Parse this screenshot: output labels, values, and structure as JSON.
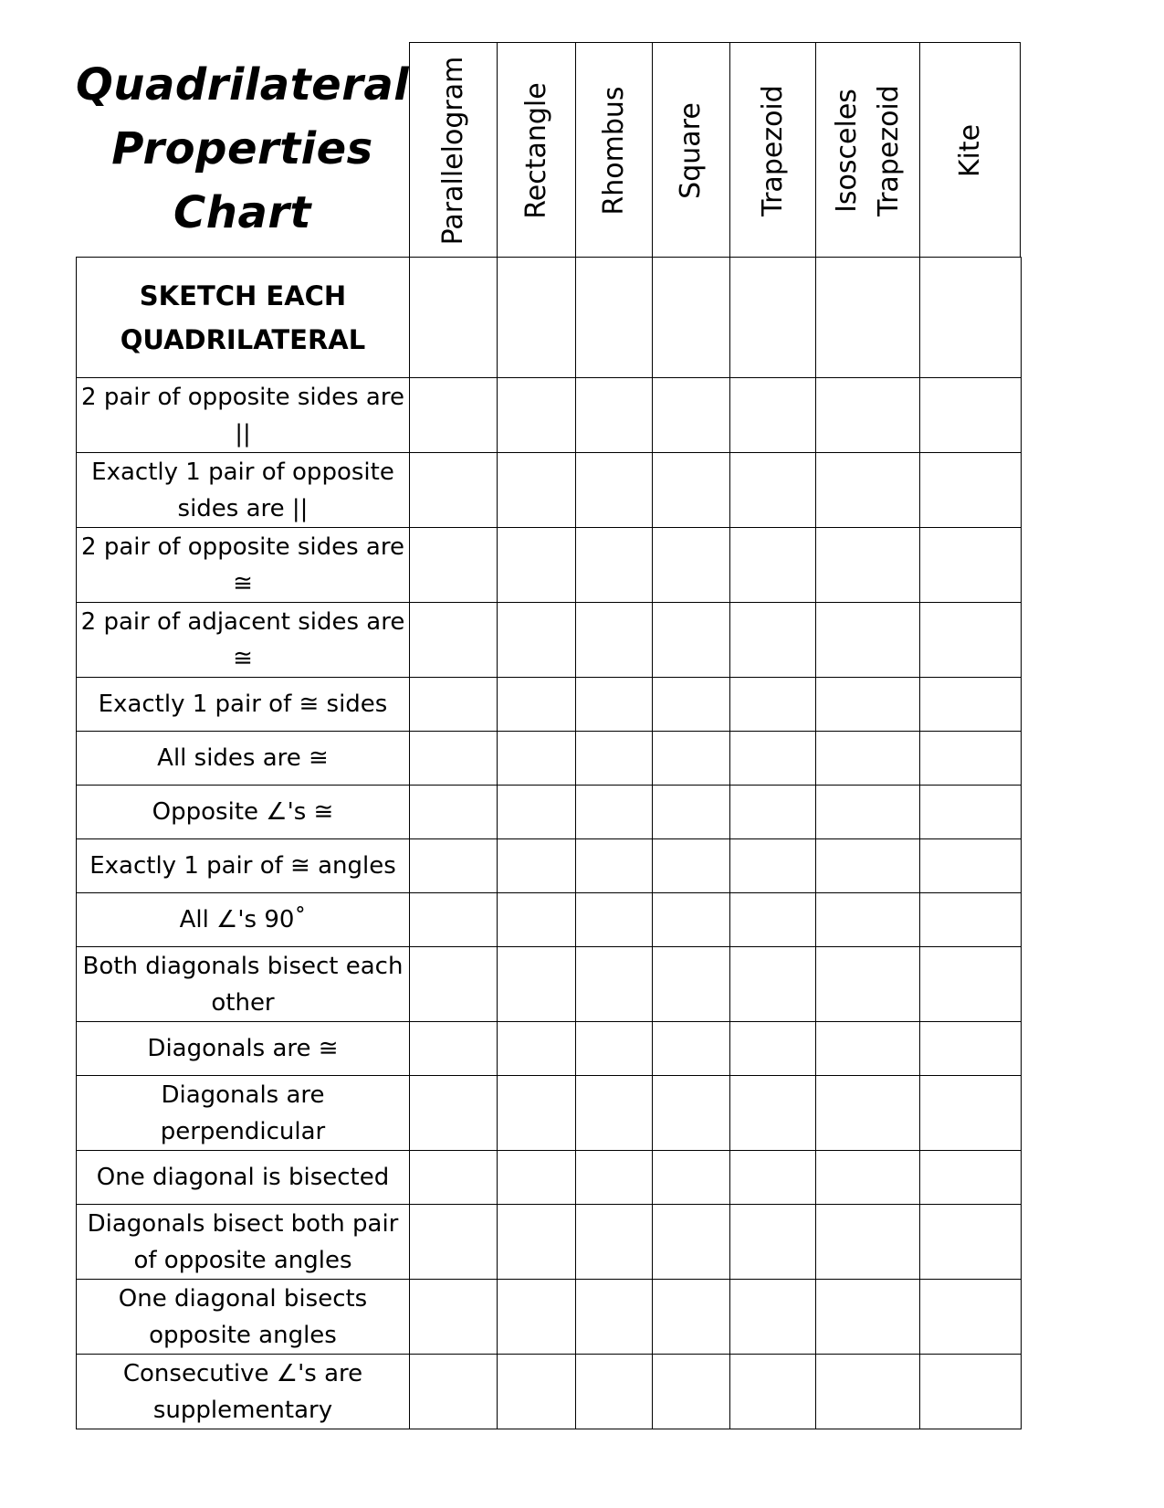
{
  "title": {
    "lines": [
      "Quadrilateral",
      "Properties",
      "Chart"
    ]
  },
  "columns": [
    {
      "label": "Parallelogram"
    },
    {
      "label": "Rectangle"
    },
    {
      "label": "Rhombus"
    },
    {
      "label": "Square"
    },
    {
      "label": "Trapezoid"
    },
    {
      "label": "Isosceles\nTrapezoid"
    },
    {
      "label": "Kite"
    }
  ],
  "rows": [
    {
      "label": "SKETCH EACH QUADRILATERAL",
      "kind": "sketch",
      "lines": 2
    },
    {
      "label": "2 pair of opposite sides are ||",
      "lines": 2
    },
    {
      "label": "Exactly 1 pair of opposite sides are ||",
      "lines": 2
    },
    {
      "label": "2 pair of opposite sides are ≅",
      "lines": 2
    },
    {
      "label": "2 pair of adjacent sides are ≅",
      "lines": 2
    },
    {
      "label": "Exactly 1 pair of ≅ sides",
      "lines": 1
    },
    {
      "label": "All sides are ≅",
      "lines": 1
    },
    {
      "label": "Opposite ∠'s ≅",
      "lines": 1
    },
    {
      "label": "Exactly 1 pair of ≅ angles",
      "lines": 1
    },
    {
      "label": "All ∠'s 90˚",
      "lines": 1
    },
    {
      "label": "Both diagonals bisect each other",
      "lines": 2
    },
    {
      "label": "Diagonals are ≅",
      "lines": 1
    },
    {
      "label": "Diagonals are perpendicular",
      "lines": 2
    },
    {
      "label": "One diagonal is bisected",
      "lines": 1
    },
    {
      "label": "Diagonals bisect both pair of opposite angles",
      "lines": 2
    },
    {
      "label": "One diagonal bisects opposite angles",
      "lines": 2
    },
    {
      "label": "Consecutive ∠'s are supplementary",
      "lines": 2
    }
  ]
}
